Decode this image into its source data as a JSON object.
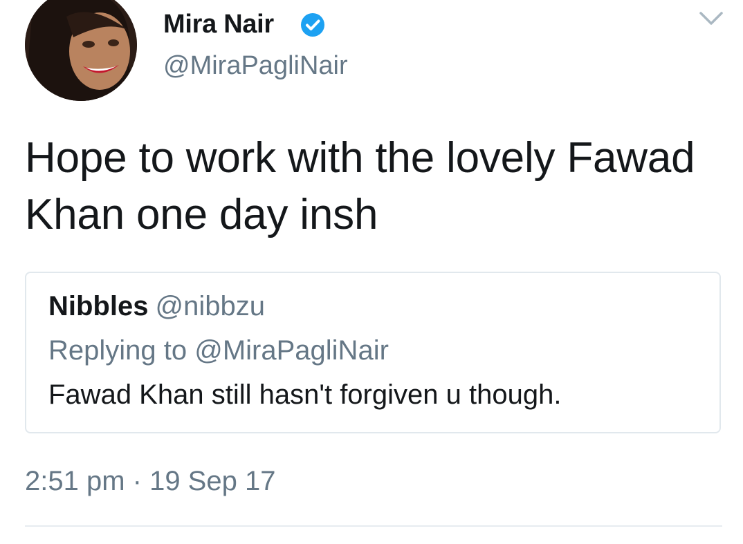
{
  "tweet": {
    "author": {
      "name": "Mira Nair",
      "handle": "@MiraPagliNair",
      "verified": true,
      "verified_icon": "verified-badge-icon",
      "verified_color": "#1da1f2"
    },
    "menu_icon": "chevron-down-icon",
    "text": "Hope to work with the lovely Fawad Khan one day insh",
    "quoted_tweet": {
      "name": "Nibbles",
      "handle": "@nibbzu",
      "replying_to": "Replying to @MiraPagliNair",
      "text": "Fawad Khan still hasn't forgiven u though."
    },
    "timestamp": "2:51 pm · 19 Sep 17"
  },
  "colors": {
    "text_primary": "#14171a",
    "text_secondary": "#657786",
    "border": "#e1e8ed"
  }
}
